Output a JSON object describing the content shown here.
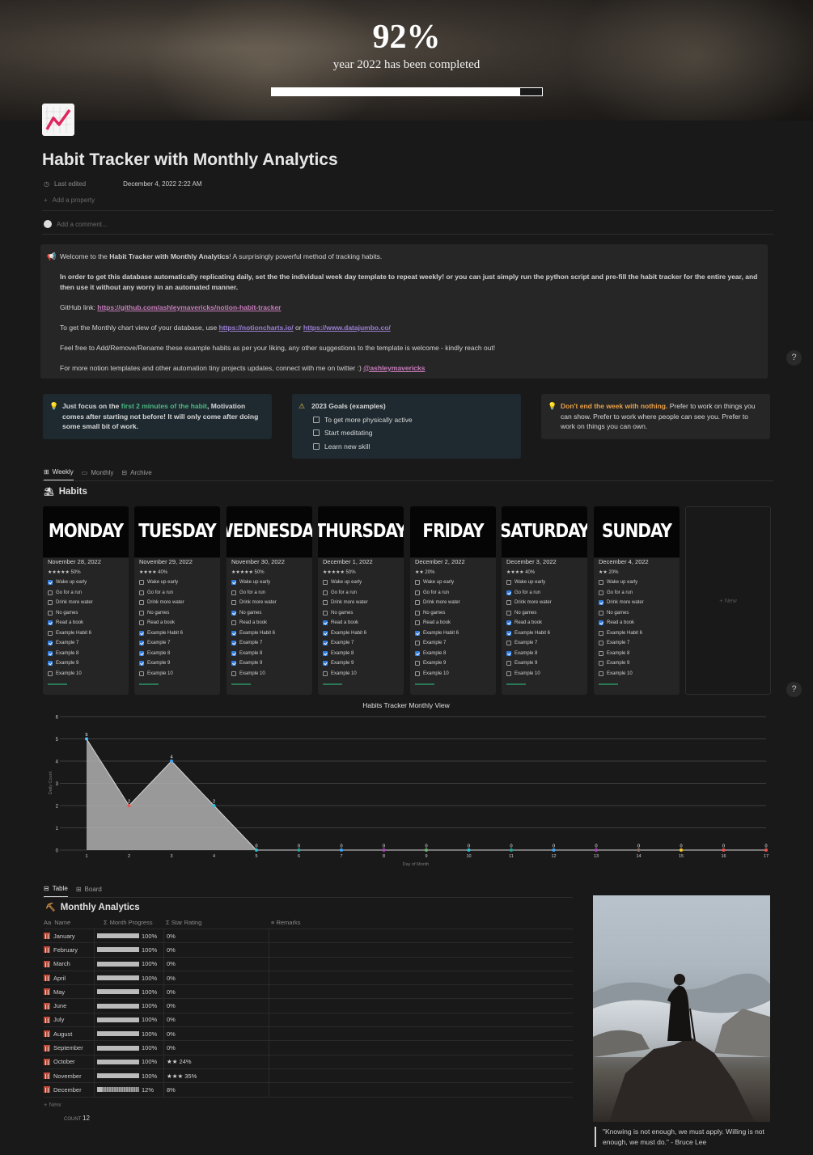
{
  "cover": {
    "percent": "92%",
    "subtitle": "year 2022 has been completed",
    "progress": 0.92
  },
  "page": {
    "title": "Habit Tracker with Monthly Analytics",
    "last_edited_label": "Last edited",
    "last_edited_value": "December 4, 2022 2:22 AM",
    "add_property": "Add a property",
    "add_comment": "Add a comment..."
  },
  "callout": {
    "welcome_pre": "Welcome to the ",
    "welcome_bold": "Habit Tracker with Monthly Analytics",
    "welcome_post": "! A surprisingly powerful method of tracking habits.",
    "instruction": "In order to get this database automatically replicating daily, set the the individual week day template to repeat weekly! or you can just simply run the python script and pre-fill the habit tracker for the entire year, and then use it without any worry in an automated manner.",
    "github_label": "GitHub link: ",
    "github_url": "https://github.com/ashleymavericks/notion-habit-tracker",
    "chart_pre": "To get the Monthly chart view of your database, use ",
    "chart_link1": "https://notioncharts.io/",
    "chart_or": " or ",
    "chart_link2": "https://www.datajumbo.co/",
    "feel_free": "Feel free to Add/Remove/Rename these example habits as per your liking, any other suggestions to the template is welcome - kindly reach out!",
    "twitter_pre": "For more notion templates and other automation tiny projects updates, connect with me on twitter :) ",
    "twitter_handle": "@ashleymavericks"
  },
  "tips": {
    "left_pre": "Just focus on the ",
    "left_green": "first 2 minutes of the habit",
    "left_post": ", Motivation comes after starting not before! It will only come after doing some small bit of work.",
    "goals_title": "2023 Goals (examples)",
    "goals": [
      "To get more physically active",
      "Start meditating",
      "Learn new skill"
    ],
    "right_orange": "Don't end the week with nothing.",
    "right_post": " Prefer to work on things you can show. Prefer to work where people can see you. Prefer to work on things you can own."
  },
  "tabs": [
    "Weekly",
    "Monthly",
    "Archive"
  ],
  "habits_title": "Habits",
  "habit_names": [
    "Wake up early",
    "Go for a run",
    "Drink more water",
    "No games",
    "Read a book",
    "Example Habit 6",
    "Example 7",
    "Example 8",
    "Example 9",
    "Example 10"
  ],
  "days": [
    {
      "name": "MONDAY",
      "date": "November 28, 2022",
      "stars": "★★★★★ 50%",
      "checks": [
        1,
        0,
        0,
        0,
        1,
        0,
        1,
        1,
        1,
        0
      ]
    },
    {
      "name": "TUESDAY",
      "date": "November 29, 2022",
      "stars": "★★★★ 40%",
      "checks": [
        0,
        0,
        0,
        0,
        0,
        1,
        1,
        1,
        1,
        0
      ]
    },
    {
      "name": "WEDNESDAY",
      "date": "November 30, 2022",
      "stars": "★★★★★ 50%",
      "checks": [
        1,
        0,
        0,
        1,
        0,
        1,
        1,
        1,
        1,
        0
      ]
    },
    {
      "name": "THURSDAY",
      "date": "December 1, 2022",
      "stars": "★★★★★ 50%",
      "checks": [
        0,
        0,
        0,
        0,
        1,
        1,
        1,
        1,
        1,
        0
      ]
    },
    {
      "name": "FRIDAY",
      "date": "December 2, 2022",
      "stars": "★★ 20%",
      "checks": [
        0,
        0,
        0,
        0,
        0,
        1,
        0,
        1,
        0,
        0
      ]
    },
    {
      "name": "SATURDAY",
      "date": "December 3, 2022",
      "stars": "★★★★ 40%",
      "checks": [
        0,
        1,
        0,
        0,
        1,
        1,
        0,
        1,
        0,
        0
      ]
    },
    {
      "name": "SUNDAY",
      "date": "December 4, 2022",
      "stars": "★★ 20%",
      "checks": [
        0,
        0,
        1,
        0,
        1,
        0,
        0,
        0,
        0,
        0
      ]
    }
  ],
  "new_label": "+ New",
  "chart_data": {
    "type": "area",
    "title": "Habits Tracker Monthly View",
    "xlabel": "Day of Month",
    "ylabel": "Daily Count",
    "ylim": [
      0,
      6
    ],
    "yticks": [
      0,
      1,
      2,
      3,
      4,
      5,
      6
    ],
    "x": [
      1,
      2,
      3,
      4,
      5,
      6,
      7,
      8,
      9,
      10,
      11,
      12,
      13,
      14,
      15,
      16,
      17
    ],
    "values": [
      5,
      2,
      4,
      2,
      0,
      0,
      0,
      0,
      0,
      0,
      0,
      0,
      0,
      0,
      0,
      0,
      0
    ],
    "point_colors": [
      "#4fc3f7",
      "#ef5350",
      "#42a5f5",
      "#26c6da",
      "#26c6da",
      "#26a69a",
      "#42a5f5",
      "#ab47bc",
      "#66bb6a",
      "#26c6da",
      "#26a69a",
      "#42a5f5",
      "#ab47bc",
      "#8d6e63",
      "#ffca28",
      "#ef5350",
      "#ef5350"
    ],
    "grid": true
  },
  "analytics": {
    "view_tabs": [
      "Table",
      "Board"
    ],
    "title": "Monthly Analytics",
    "columns": [
      "Name",
      "Month Progress",
      "Star Rating",
      "Remarks"
    ],
    "rows": [
      {
        "name": "January",
        "progress": "100%",
        "progress_value": 1.0,
        "rating": "0%"
      },
      {
        "name": "February",
        "progress": "100%",
        "progress_value": 1.0,
        "rating": "0%"
      },
      {
        "name": "March",
        "progress": "100%",
        "progress_value": 1.0,
        "rating": "0%"
      },
      {
        "name": "April",
        "progress": "100%",
        "progress_value": 1.0,
        "rating": "0%"
      },
      {
        "name": "May",
        "progress": "100%",
        "progress_value": 1.0,
        "rating": "0%"
      },
      {
        "name": "June",
        "progress": "100%",
        "progress_value": 1.0,
        "rating": "0%"
      },
      {
        "name": "July",
        "progress": "100%",
        "progress_value": 1.0,
        "rating": "0%"
      },
      {
        "name": "August",
        "progress": "100%",
        "progress_value": 1.0,
        "rating": "0%"
      },
      {
        "name": "September",
        "progress": "100%",
        "progress_value": 1.0,
        "rating": "0%"
      },
      {
        "name": "October",
        "progress": "100%",
        "progress_value": 1.0,
        "rating": "★★ 24%"
      },
      {
        "name": "November",
        "progress": "100%",
        "progress_value": 1.0,
        "rating": "★★★ 35%"
      },
      {
        "name": "December",
        "progress": "12%",
        "progress_value": 0.12,
        "rating": "8%"
      }
    ],
    "new_label": "+ New",
    "count_label": "COUNT",
    "count_value": "12"
  },
  "quote": "\"Knowing is not enough, we must apply. Willing is not enough, we must do.\" - Bruce Lee",
  "help_label": "?"
}
